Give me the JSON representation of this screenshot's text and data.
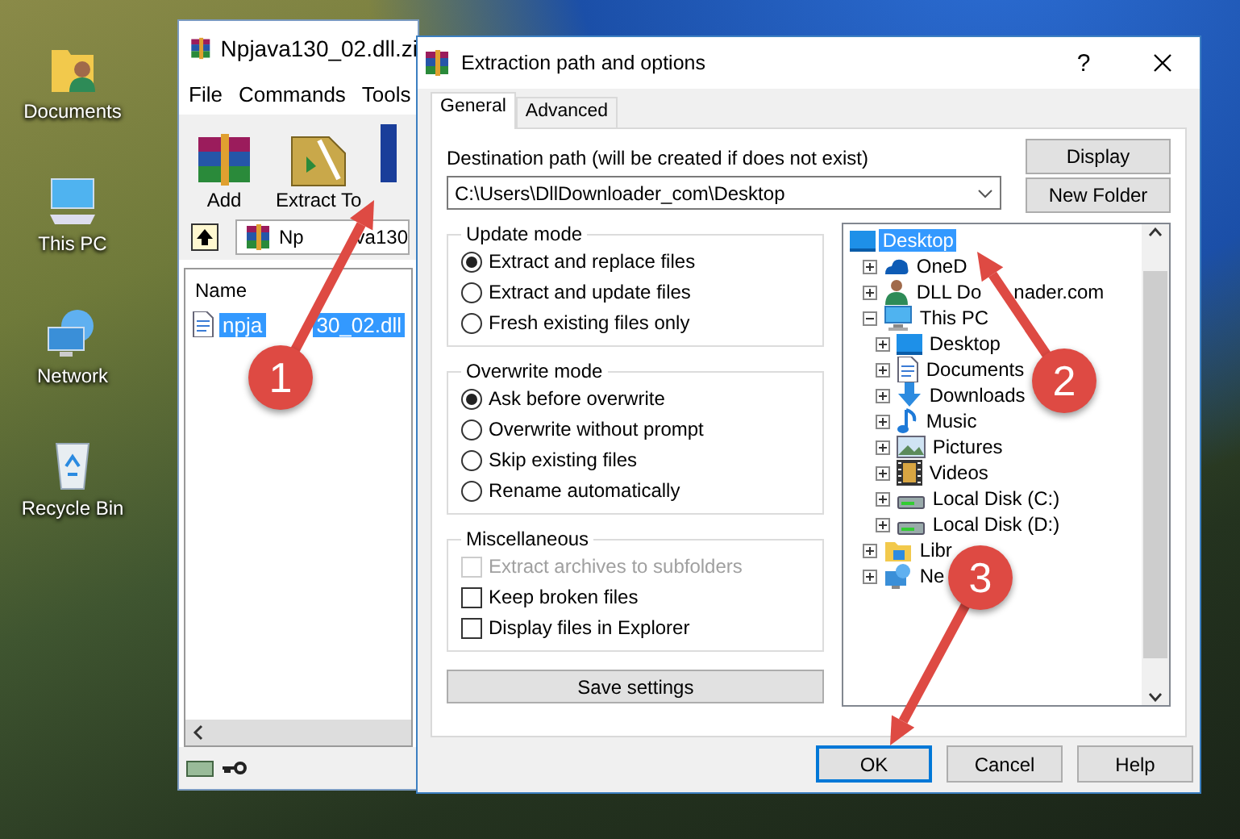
{
  "desktop": {
    "icons": [
      {
        "label": "Documents",
        "kind": "documents"
      },
      {
        "label": "This PC",
        "kind": "pc"
      },
      {
        "label": "Network",
        "kind": "network"
      },
      {
        "label": "Recycle Bin",
        "kind": "recycle"
      }
    ]
  },
  "archiver_window": {
    "title": "Npjava130_02.dll.zi",
    "menu": [
      "File",
      "Commands",
      "Tools"
    ],
    "toolbar": [
      {
        "label": "Add",
        "kind": "add"
      },
      {
        "label": "Extract To",
        "kind": "extract"
      }
    ],
    "address_parts": [
      "Np",
      "va130"
    ],
    "columns": [
      "Name"
    ],
    "files": [
      {
        "name_parts": [
          "npja",
          "30_02.dll"
        ],
        "selected": true
      }
    ]
  },
  "dialog": {
    "title": "Extraction path and options",
    "help": "?",
    "tabs": [
      {
        "label": "General",
        "selected": true
      },
      {
        "label": "Advanced",
        "selected": false
      }
    ],
    "destination_label": "Destination path (will be created if does not exist)",
    "destination_path": "C:\\Users\\DllDownloader_com\\Desktop",
    "side_buttons": [
      "Display",
      "New Folder"
    ],
    "update_mode": {
      "title": "Update mode",
      "options": [
        {
          "label": "Extract and replace files",
          "selected": true
        },
        {
          "label": "Extract and update files",
          "selected": false
        },
        {
          "label": "Fresh existing files only",
          "selected": false
        }
      ]
    },
    "overwrite_mode": {
      "title": "Overwrite mode",
      "options": [
        {
          "label": "Ask before overwrite",
          "selected": true
        },
        {
          "label": "Overwrite without prompt",
          "selected": false
        },
        {
          "label": "Skip existing files",
          "selected": false
        },
        {
          "label": "Rename automatically",
          "selected": false
        }
      ]
    },
    "miscellaneous": {
      "title": "Miscellaneous",
      "options": [
        {
          "label": "Extract archives to subfolders",
          "checked": false,
          "disabled": true
        },
        {
          "label": "Keep broken files",
          "checked": false,
          "disabled": false
        },
        {
          "label": "Display files in Explorer",
          "checked": false,
          "disabled": false
        }
      ]
    },
    "save_button": "Save settings",
    "tree": [
      {
        "label_parts": [
          "Desktop"
        ],
        "kind": "desktop",
        "selected": true,
        "children": [
          {
            "label_parts": [
              "OneD"
            ],
            "kind": "cloud",
            "selected": false,
            "expanded": false
          },
          {
            "label_parts": [
              "DLL Do",
              "nader.com"
            ],
            "kind": "user",
            "selected": false,
            "expanded": false
          },
          {
            "label_parts": [
              "This PC"
            ],
            "kind": "pc",
            "selected": false,
            "expanded": true,
            "children": [
              {
                "label_parts": [
                  "Desktop"
                ],
                "kind": "desktop",
                "selected": false,
                "expanded": false
              },
              {
                "label_parts": [
                  "Documents"
                ],
                "kind": "documents",
                "selected": false,
                "expanded": false
              },
              {
                "label_parts": [
                  "Downloads"
                ],
                "kind": "downloads",
                "selected": false,
                "expanded": false
              },
              {
                "label_parts": [
                  "Music"
                ],
                "kind": "music",
                "selected": false,
                "expanded": false
              },
              {
                "label_parts": [
                  "Pictures"
                ],
                "kind": "pictures",
                "selected": false,
                "expanded": false
              },
              {
                "label_parts": [
                  "Videos"
                ],
                "kind": "videos",
                "selected": false,
                "expanded": false
              },
              {
                "label_parts": [
                  "Local Disk (C:)"
                ],
                "kind": "drive",
                "selected": false,
                "expanded": false
              },
              {
                "label_parts": [
                  "Local Disk (D:)"
                ],
                "kind": "drive",
                "selected": false,
                "expanded": false
              }
            ]
          },
          {
            "label_parts": [
              "Libr"
            ],
            "kind": "library",
            "selected": false,
            "expanded": false
          },
          {
            "label_parts": [
              "Ne"
            ],
            "kind": "network",
            "selected": false,
            "expanded": false
          }
        ]
      }
    ],
    "buttons": [
      {
        "label": "OK",
        "default": true
      },
      {
        "label": "Cancel",
        "default": false
      },
      {
        "label": "Help",
        "default": false
      }
    ]
  },
  "callouts": [
    {
      "number": "1"
    },
    {
      "number": "2"
    },
    {
      "number": "3"
    }
  ]
}
